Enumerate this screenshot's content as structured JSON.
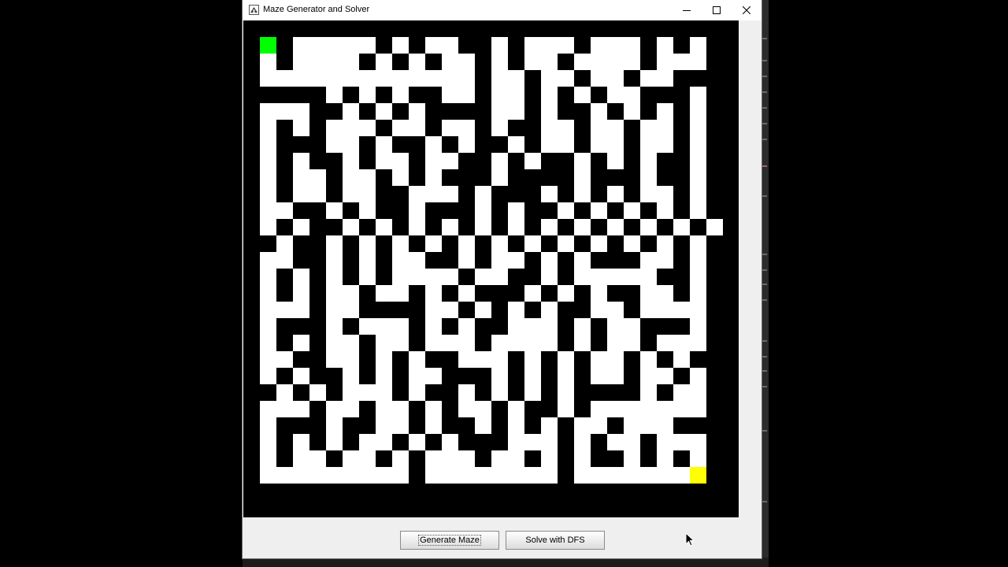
{
  "window": {
    "title": "Maze Generator and Solver",
    "controls": [
      "minimize",
      "maximize",
      "close"
    ]
  },
  "buttons": {
    "generate_label": "Generate Maze",
    "solve_label": "Solve with DFS"
  },
  "maze": {
    "grid_cols": 29,
    "grid_rows": 29,
    "wall_color": "#000000",
    "path_color": "#ffffff",
    "start_color": "#00ff00",
    "end_color": "#ffff00",
    "start_cell": [
      1,
      1
    ],
    "end_cell": [
      27,
      27
    ],
    "rows": [
      "#############################",
      "#S#.....#.#..##.#...#...#.#.#",
      "#.#....#.#.#..#.#..#....#...#",
      "#.............#..#..#..#..###",
      "#####.#.#.##..#..#.#.#..###.#",
      "#...##.#.#.####..#.##.#.#.#.#",
      "#.#.#...#..#..#.##..#..#..#.#",
      "#.###..#.##.#.##.#..#..#..#.#",
      "#.#.##.#..#..##.#.##.#.#.##.#",
      "#.#..#..#.#.###.####.###.##.#",
      "#.#..#..##...#.###.#.#.#..#.#",
      "#..##.#.##.###.#.##.#.#.#.#.#",
      "#.#.##.#.#.#.#.#.#.#.#.#.#.#.",
      "##.##.#.#.#.#.#.#.#.#.#.#.#.#",
      "#..##.#.#..##.#..#.#.###..#.#",
      "#.#.#.#.#....#..##.#.....##.#",
      "#.#.#..#..#.#.###.#.#.##..#.#",
      "#...#..####..#.#.#.##..#....#",
      "#.###.#...#.#.##...#.#..###.#",
      "#.#.#..#..#...#....#.#..#...#",
      "#..##..#.#.##...#.#.#..#.#.##",
      "#.#.##.#.#..###.#.#.#..#..#.#",
      "##.#.#...#.##.#.#.#.####.#..#",
      "#...#..#..#.#..#.##.#.......#",
      "#.###.##..#.##.#.#.#..#...###",
      "#.#.#.#..#.#.###...#.#..#...#",
      "#.#..#..#.#...#..#.#.##.#.#.#",
      "#.........#........#.......E#",
      "#############################"
    ]
  }
}
